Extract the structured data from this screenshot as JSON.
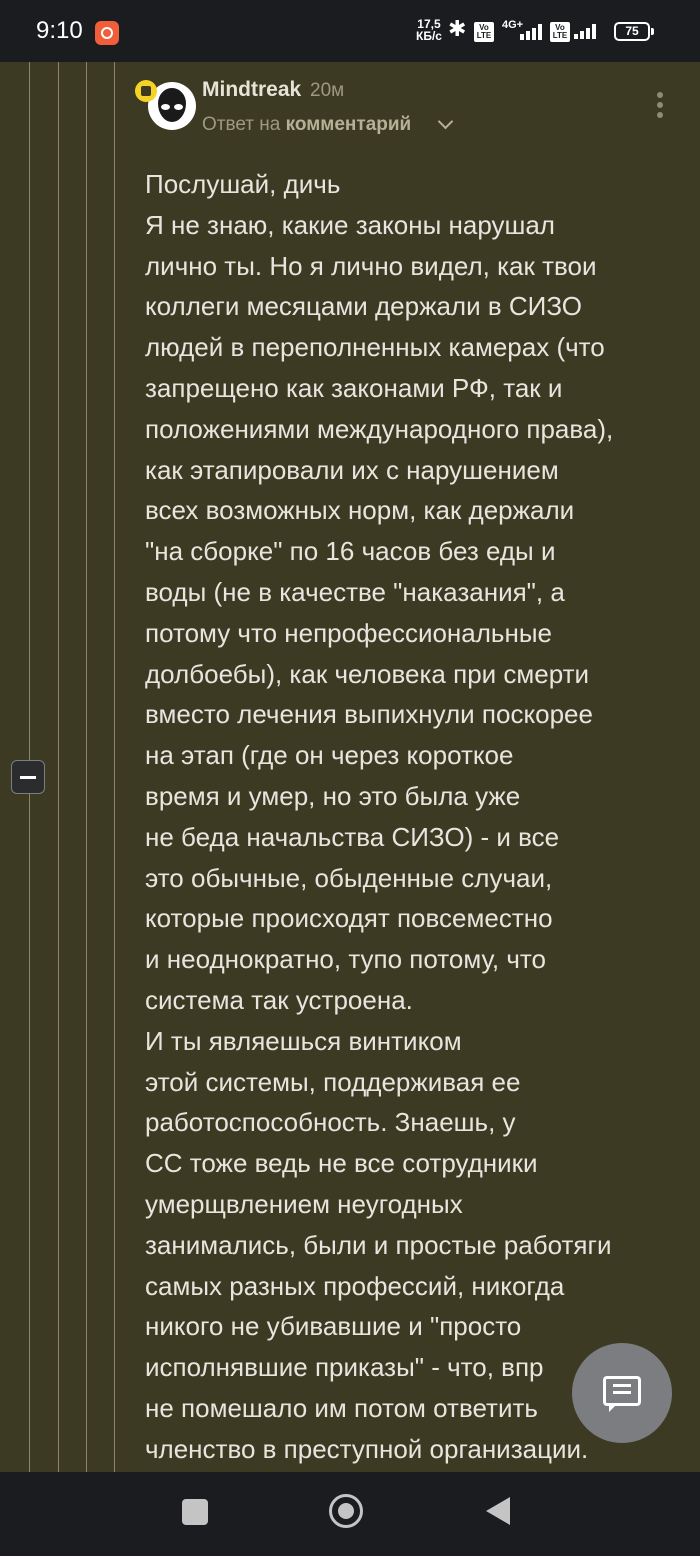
{
  "status_bar": {
    "time": "9:10",
    "net_speed_value": "17,5",
    "net_speed_unit": "КБ/с",
    "sim1_label": "Vo LTE",
    "network_type": "4G+",
    "sim2_label": "Vo LTE",
    "battery": "75"
  },
  "comment": {
    "author": "Mindtreak",
    "time_ago": "20м",
    "reply_prefix": "Ответ на",
    "reply_target": "комментарий",
    "lines": [
      "Послушай, дичь",
      "Я не знаю, какие законы нарушал",
      "лично ты. Но я лично видел, как твои",
      "коллеги месяцами держали в СИЗО",
      "людей в переполненных камерах (что",
      "запрещено как законами РФ, так и",
      "положениями международного права),",
      "как этапировали их с нарушением",
      "всех возможных норм, как держали",
      "\"на сборке\" по 16 часов без еды и",
      "воды (не в качестве \"наказания\", а",
      "потому что непрофессиональные",
      "долбоебы), как человека при смерти",
      "вместо лечения выпихнули поскорее",
      "на этап (где он через короткое",
      "время и умер, но это была уже",
      "не беда начальства СИЗО) - и все",
      "это обычные, обыденные случаи,",
      "которые происходят повсеместно",
      "и неоднократно, тупо потому, что",
      "система так устроена.",
      "И ты являешься винтиком",
      "этой системы, поддерживая ее",
      "работоспособность. Знаешь, у",
      "СС тоже ведь не все сотрудники",
      "умерщвлением неугодных",
      "занимались, были и простые работяги",
      "самых разных профессий, никогда",
      "никого не убивавшие и \"просто",
      "исполнявшие приказы\" - что, впр",
      "не помешало им потом ответить",
      "членство в преступной организации."
    ]
  },
  "colors": {
    "background": "#3d3a24",
    "text": "#e6e5de",
    "muted": "#9d9a80",
    "badge": "#f5d325",
    "bar": "#1b1c1f"
  },
  "icons": {
    "collapse": "minus-icon",
    "more": "more-vertical-icon",
    "fab": "comment-icon",
    "nav_recents": "square-icon",
    "nav_home": "circle-icon",
    "nav_back": "triangle-back-icon"
  }
}
